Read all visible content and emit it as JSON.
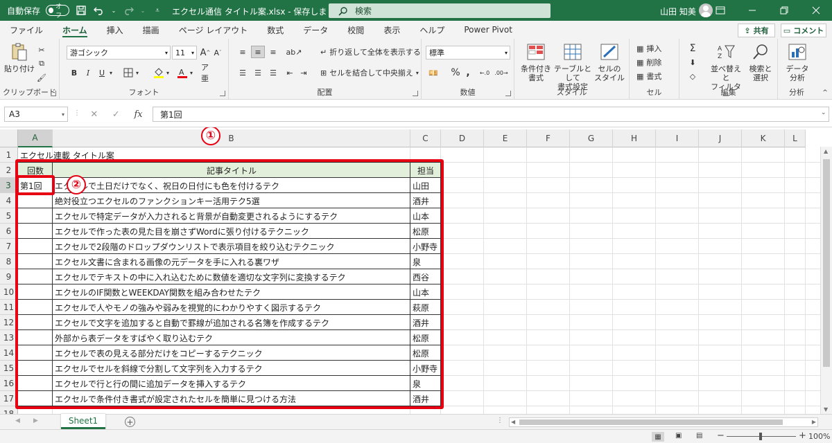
{
  "titlebar": {
    "autosave_label": "自動保存",
    "autosave_state": "オフ",
    "document_title": "エクセル通信 タイトル案.xlsx - 保存しました",
    "search_placeholder": "検索",
    "user_name": "山田 知美",
    "accent_color": "#217346"
  },
  "menu": {
    "tabs": [
      "ファイル",
      "ホーム",
      "挿入",
      "描画",
      "ページ レイアウト",
      "数式",
      "データ",
      "校閲",
      "表示",
      "ヘルプ",
      "Power Pivot"
    ],
    "share_label": "共有",
    "comment_label": "コメント"
  },
  "ribbon": {
    "clipboard": {
      "label": "クリップボード",
      "paste": "貼り付け"
    },
    "font": {
      "label": "フォント",
      "font_name": "游ゴシック",
      "font_size": "11"
    },
    "alignment": {
      "label": "配置",
      "wrap_text": "折り返して全体を表示する",
      "merge_center": "セルを結合して中央揃え"
    },
    "number": {
      "label": "数値",
      "format": "標準"
    },
    "styles": {
      "label": "スタイル",
      "conditional_line1": "条件付き",
      "conditional_line2": "書式",
      "table_line1": "テーブルとして",
      "table_line2": "書式設定",
      "cell_line1": "セルの",
      "cell_line2": "スタイル"
    },
    "cells": {
      "label": "セル",
      "insert": "挿入",
      "delete": "削除",
      "format": "書式"
    },
    "editing": {
      "label": "編集",
      "sort_line1": "並べ替えと",
      "sort_line2": "フィルター",
      "find_line1": "検索と",
      "find_line2": "選択"
    },
    "analysis": {
      "label": "分析",
      "data_line1": "データ",
      "data_line2": "分析"
    }
  },
  "formula_bar": {
    "name_box": "A3",
    "formula": "第1回"
  },
  "sheet": {
    "columns": [
      "A",
      "B",
      "C",
      "D",
      "E",
      "F",
      "G",
      "H",
      "I",
      "J",
      "K",
      "L"
    ],
    "rows": [
      "1",
      "2",
      "3",
      "4",
      "5",
      "6",
      "7",
      "8",
      "9",
      "10",
      "11",
      "12",
      "13",
      "14",
      "15",
      "16",
      "17",
      "18"
    ],
    "title_cell": "エクセル連載 タイトル案",
    "headers": {
      "col_a": "回数",
      "col_b": "記事タイトル",
      "col_c": "担当"
    },
    "records": [
      {
        "number": "第1回",
        "title": "エクセルで土日だけでなく、祝日の日付にも色を付けるテク",
        "owner": "山田"
      },
      {
        "number": "",
        "title": "絶対役立つエクセルのファンクションキー活用テク5選",
        "owner": "酒井"
      },
      {
        "number": "",
        "title": "エクセルで特定データが入力されると背景が自動変更されるようにするテク",
        "owner": "山本"
      },
      {
        "number": "",
        "title": "エクセルで作った表の見た目を崩さずWordに張り付けるテクニック",
        "owner": "松原"
      },
      {
        "number": "",
        "title": "エクセルで2段階のドロップダウンリストで表示項目を絞り込むテクニック",
        "owner": "小野寺"
      },
      {
        "number": "",
        "title": "エクセル文書に含まれる画像の元データを手に入れる裏ワザ",
        "owner": "泉"
      },
      {
        "number": "",
        "title": "エクセルでテキストの中に入れ込むために数値を適切な文字列に変換するテク",
        "owner": "西谷"
      },
      {
        "number": "",
        "title": "エクセルのIF関数とWEEKDAY関数を組み合わせたテク",
        "owner": "山本"
      },
      {
        "number": "",
        "title": "エクセルで人やモノの強みや弱みを視覚的にわかりやすく図示するテク",
        "owner": "萩原"
      },
      {
        "number": "",
        "title": "エクセルで文字を追加すると自動で罫線が追加される名簿を作成するテク",
        "owner": "酒井"
      },
      {
        "number": "",
        "title": "外部から表データをすばやく取り込むテク",
        "owner": "松原"
      },
      {
        "number": "",
        "title": "エクセルで表の見える部分だけをコピーするテクニック",
        "owner": "松原"
      },
      {
        "number": "",
        "title": "エクセルでセルを斜線で分割して文字列を入力するテク",
        "owner": "小野寺"
      },
      {
        "number": "",
        "title": "エクセルで行と行の間に追加データを挿入するテク",
        "owner": "泉"
      },
      {
        "number": "",
        "title": "エクセルで条件付き書式が設定されたセルを簡単に見つける方法",
        "owner": "酒井"
      }
    ],
    "header_fill_color": "#e2efda"
  },
  "annotations": {
    "badge_1": "①",
    "badge_2": "②",
    "highlight_color": "#e60012"
  },
  "sheet_tabs": {
    "active": "Sheet1"
  },
  "status": {
    "zoom": "100%"
  }
}
